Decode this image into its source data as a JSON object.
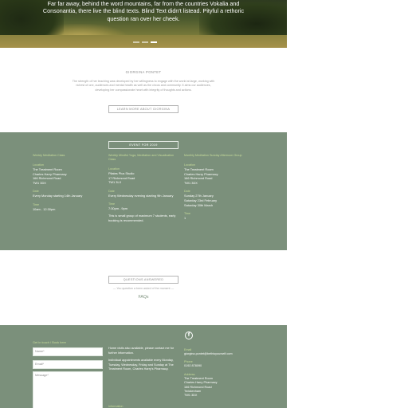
{
  "hero": {
    "text": "Far far away, behind the word mountains, far from the countries Vokalia and Consonantia, there live the blind texts. Blind Text didn't listead. Pityful a rethoric question ran over her cheek.",
    "slides": [
      false,
      false,
      true
    ]
  },
  "intro": {
    "heading": "GIORGINA PONTET",
    "body": "The strength of her teaching was developed by her willingness to engage with the world at large, working with richest of one, audiences and mental health as well as the circus and community. It aims our audiences, developing her compassionate heart with integrity of thoughts and actions.",
    "button": "LEARN MORE ABOUT GIORGINA"
  },
  "events": {
    "button": "EVENT FOR 2019",
    "columns": [
      {
        "title": "Weekly Meditation Class",
        "sections": [
          {
            "label": "Location",
            "lines": [
              "The Treatment Room",
              "Charles Harry Pharmacy",
              "166 Richmond Road",
              "TW1 3DX"
            ]
          },
          {
            "label": "Date",
            "lines": [
              "Every Monday starting 14th January"
            ]
          },
          {
            "label": "Time",
            "lines": [
              "10am - 12:30pm"
            ]
          }
        ],
        "note": ""
      },
      {
        "title": "Weekly Mindful Yoga, Meditation and Visualisation Class",
        "sections": [
          {
            "label": "Location",
            "lines": [
              "Pilates Plus Studio",
              "17 Richmond Road",
              "TW1 3LX"
            ]
          },
          {
            "label": "Date",
            "lines": [
              "Every Wednesday evening starting 9th January"
            ]
          },
          {
            "label": "Time",
            "lines": [
              "7:30pm - 9pm"
            ]
          }
        ],
        "note": "This is small group of maximum 7 students, early booking is recommended."
      },
      {
        "title": "Monthly Meditation Sunday Afternoon Group",
        "sections": [
          {
            "label": "Location",
            "lines": [
              "The Treatment Room",
              "Charles Harry Pharmacy",
              "166 Richmond Road",
              "TW1 3DX"
            ]
          },
          {
            "label": "Date",
            "lines": [
              "Sunday 27th January",
              "Saturday 23rd February",
              "Saturday 30th March"
            ]
          },
          {
            "label": "Time",
            "lines": [
              "1"
            ]
          }
        ],
        "note": ""
      }
    ]
  },
  "faq": {
    "button": "QUESTIONS ANSWERED",
    "subtitle": "— You question a been asked of the moment —",
    "link": "FAQs"
  },
  "footer": {
    "form_title": "Get in touch / Book here",
    "name_placeholder": "Name*",
    "email_placeholder": "Email*",
    "message_placeholder": "Message*",
    "mid_paragraphs": [
      "Home visits also available, please contact me for further information.",
      "Individual appointments available every Monday, Tuesday, Wednesday, Friday and Sunday at The Treatment Room, Charles Harry's Pharmacy."
    ],
    "mid_label": "Information",
    "facebook_icon": "facebook-icon",
    "right": [
      {
        "label": "Email",
        "lines": [
          "giorgina.pontet@bethisyourself.com"
        ]
      },
      {
        "label": "Phone",
        "lines": [
          "0192 878090"
        ]
      },
      {
        "label": "Address",
        "lines": [
          "The Treatment Room",
          "Charles Harry Pharmacy",
          "166 Richmond Road",
          "Twickenham",
          "TW1 3DX"
        ]
      }
    ]
  },
  "colors": {
    "sage": "#7b907b",
    "accent_green": "#c7dd9b",
    "white": "#ffffff"
  }
}
